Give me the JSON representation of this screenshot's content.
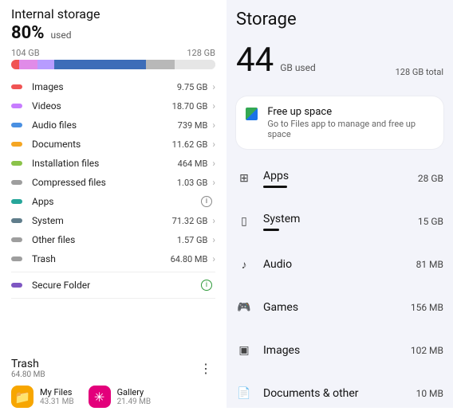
{
  "left": {
    "title": "Internal storage",
    "percent": "80%",
    "used_label": "used",
    "range_lo": "104 GB",
    "range_hi": "128 GB",
    "segments": [
      {
        "color": "#f05454",
        "pct": 4
      },
      {
        "color": "#e08be8",
        "pct": 9
      },
      {
        "color": "#b79cff",
        "pct": 8
      },
      {
        "color": "#3d6db8",
        "pct": 45
      },
      {
        "color": "#b8b8b8",
        "pct": 14
      },
      {
        "color": "#e6e6e6",
        "pct": 20
      }
    ],
    "categories": [
      {
        "label": "Images",
        "size": "9.75 GB",
        "color": "#f05454",
        "type": "chev"
      },
      {
        "label": "Videos",
        "size": "18.70 GB",
        "color": "#c77dff",
        "type": "chev"
      },
      {
        "label": "Audio files",
        "size": "739 MB",
        "color": "#4a90e2",
        "type": "chev"
      },
      {
        "label": "Documents",
        "size": "11.62 GB",
        "color": "#f5a623",
        "type": "chev"
      },
      {
        "label": "Installation files",
        "size": "464 MB",
        "color": "#8bc34a",
        "type": "chev"
      },
      {
        "label": "Compressed files",
        "size": "1.03 GB",
        "color": "#9e9e9e",
        "type": "chev"
      },
      {
        "label": "Apps",
        "size": "",
        "color": "#26a69a",
        "type": "info"
      },
      {
        "label": "System",
        "size": "71.32 GB",
        "color": "#607d8b",
        "type": "chev"
      },
      {
        "label": "Other files",
        "size": "1.57 GB",
        "color": "#9e9e9e",
        "type": "chev"
      },
      {
        "label": "Trash",
        "size": "64.80 MB",
        "color": "#9e9e9e",
        "type": "chev"
      },
      {
        "label": "Secure Folder",
        "size": "",
        "color": "#7e57c2",
        "type": "info-green",
        "divider_before": true
      }
    ],
    "trash": {
      "title": "Trash",
      "size": "64.80 MB",
      "apps": [
        {
          "name": "My Files",
          "size": "43.31 MB",
          "icon": "folder",
          "color": "orange"
        },
        {
          "name": "Gallery",
          "size": "21.49 MB",
          "icon": "flower",
          "color": "pink"
        }
      ]
    }
  },
  "right": {
    "title": "Storage",
    "big": "44",
    "big_unit": "GB used",
    "total": "128 GB total",
    "fill_pct": 34,
    "free": {
      "title": "Free up space",
      "sub": "Go to Files app to manage and free up space"
    },
    "categories": [
      {
        "icon": "⊞",
        "label": "Apps",
        "size": "28 GB",
        "bar": 30
      },
      {
        "icon": "▯",
        "label": "System",
        "size": "15 GB",
        "bar": 20
      },
      {
        "icon": "♪",
        "label": "Audio",
        "size": "81 MB",
        "bar": 0
      },
      {
        "icon": "🎮",
        "label": "Games",
        "size": "156 MB",
        "bar": 0
      },
      {
        "icon": "▣",
        "label": "Images",
        "size": "102 MB",
        "bar": 0
      },
      {
        "icon": "📄",
        "label": "Documents & other",
        "size": "10 MB",
        "bar": 0
      }
    ]
  }
}
